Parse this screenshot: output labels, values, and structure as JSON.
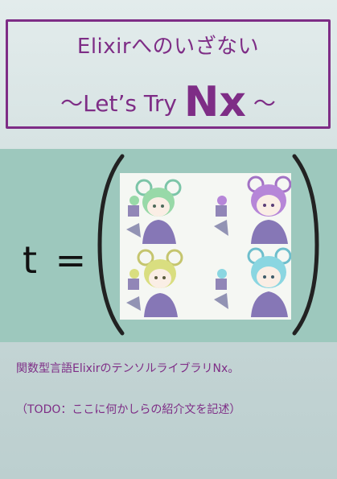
{
  "title": {
    "line1": "Elixirへのいざない",
    "line2_prefix": "〜Let’s Try ",
    "line2_big": "Nx",
    "line2_suffix": " 〜"
  },
  "equation": {
    "lhs": "t ="
  },
  "matrix": {
    "cells": [
      {
        "name": "green-hair-character",
        "hair": "#8fd6a0"
      },
      {
        "name": "purple-hair-character",
        "hair": "#b07ad6"
      },
      {
        "name": "yellow-hair-character",
        "hair": "#d6dc74"
      },
      {
        "name": "cyan-hair-character",
        "hair": "#7fd3e0"
      }
    ]
  },
  "description": {
    "line1": "関数型言語ElixirのテンソルライブラリNx。",
    "line2": "（TODO：ここに何かしらの紹介文を記述）"
  },
  "colors": {
    "accent": "#7e2d86",
    "band": "#9dc8bd"
  }
}
